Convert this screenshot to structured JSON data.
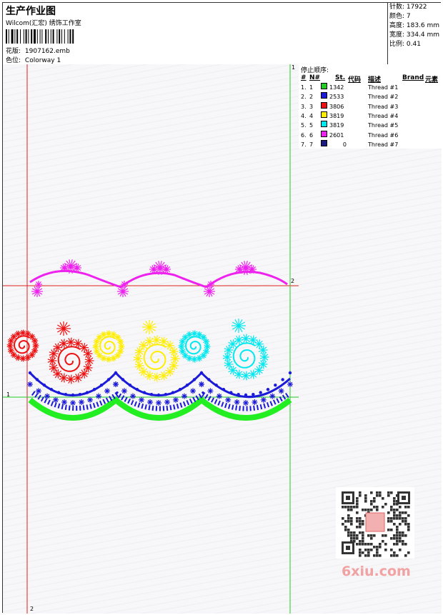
{
  "header": {
    "title": "生产作业图",
    "company": "Wilcom(汇宏) 绣饰工作室",
    "design_file_label": "花版:",
    "design_file": "1907162.emb",
    "colorway_label": "色位:",
    "colorway": "Colorway 1"
  },
  "stats": {
    "stitches": "针数: 17922",
    "colors": "颜色: 7",
    "height": "高度: 183.6 mm",
    "width": "宽度: 334.4 mm",
    "scale": "比例: 0.41"
  },
  "threads": {
    "header": "停止顺序:",
    "columns": [
      "#",
      "N#",
      "St.",
      "代码",
      "描述",
      "Brand",
      "元素"
    ],
    "rows": [
      {
        "num": "1.",
        "n": "1",
        "st": "1342",
        "desc": "Thread #1",
        "color": "#22cc22"
      },
      {
        "num": "2.",
        "n": "2",
        "st": "2533",
        "desc": "Thread #2",
        "color": "#1a1ad8"
      },
      {
        "num": "3.",
        "n": "3",
        "st": "3806",
        "desc": "Thread #3",
        "color": "#ee1111"
      },
      {
        "num": "4.",
        "n": "4",
        "st": "3819",
        "desc": "Thread #4",
        "color": "#ffee00"
      },
      {
        "num": "5.",
        "n": "5",
        "st": "3819",
        "desc": "Thread #5",
        "color": "#00e8f0"
      },
      {
        "num": "6.",
        "n": "6",
        "st": "2601",
        "desc": "Thread #6",
        "color": "#ee22ee"
      },
      {
        "num": "7.",
        "n": "7",
        "st": "0",
        "desc": "Thread #7",
        "color": "#1a1a80"
      }
    ]
  },
  "guides": {
    "label_1": "1",
    "label_2": "2"
  },
  "watermark": "6xiu.com"
}
